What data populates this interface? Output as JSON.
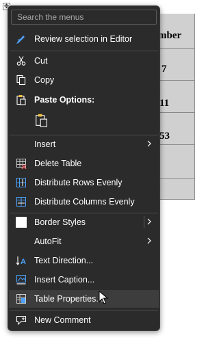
{
  "table": {
    "move_handle_icon": "move-arrows-icon",
    "header_partial": "mber",
    "cells": [
      "7",
      "11",
      "53"
    ]
  },
  "menu": {
    "search_placeholder": "Search the menus",
    "items": {
      "review": "Review selection in Editor",
      "cut": "Cut",
      "copy": "Copy",
      "paste_options": "Paste Options:",
      "insert": "Insert",
      "delete_table": "Delete Table",
      "distribute_rows": "Distribute Rows Evenly",
      "distribute_columns": "Distribute Columns Evenly",
      "border_styles": "Border Styles",
      "autofit": "AutoFit",
      "text_direction": "Text Direction...",
      "insert_caption": "Insert Caption...",
      "table_properties": "Table Properties...",
      "new_comment": "New Comment"
    },
    "hovered_item": "Table Properties...",
    "colors": {
      "background": "#2b2b2b",
      "hover": "#3d3d3d",
      "accent_blue": "#4da3ff",
      "delete_red": "#e05555"
    }
  }
}
